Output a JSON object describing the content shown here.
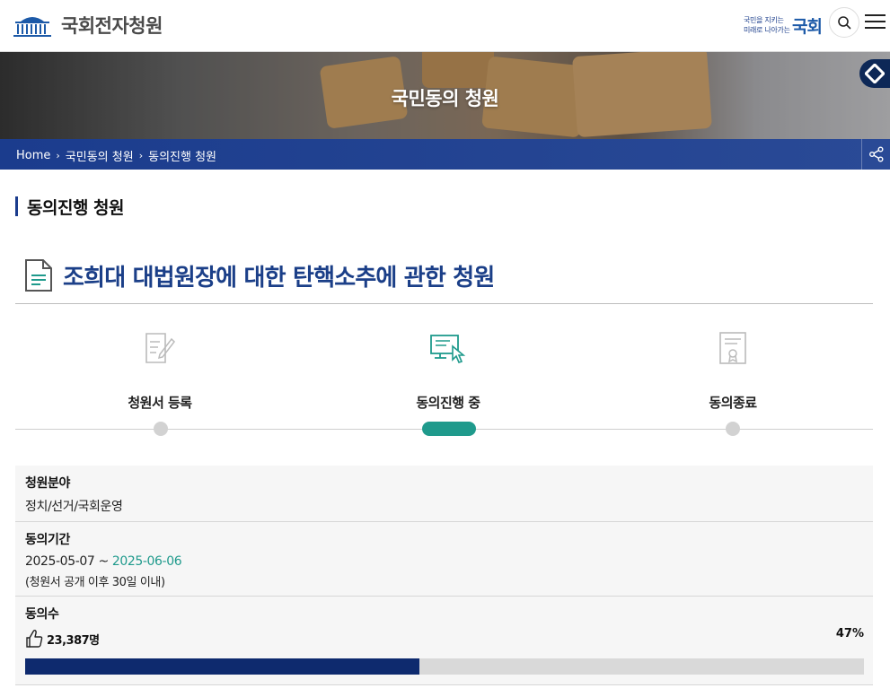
{
  "header": {
    "site_title": "국회전자청원",
    "slogan_line1": "국민을 지키는",
    "slogan_line2": "미래로 나아가는",
    "slogan_big": "국회",
    "search_icon": "search-icon",
    "menu_icon": "hamburger-menu-icon"
  },
  "banner": {
    "title": "국민동의 청원"
  },
  "breadcrumb": {
    "items": [
      "Home",
      "국민동의 청원",
      "동의진행 청원"
    ]
  },
  "section": {
    "title": "동의진행 청원"
  },
  "petition": {
    "title": "조희대 대법원장에 대한 탄핵소추에 관한 청원"
  },
  "steps": [
    {
      "label": "청원서 등록",
      "icon": "document-edit-icon",
      "active": false
    },
    {
      "label": "동의진행 중",
      "icon": "computer-click-icon",
      "active": true
    },
    {
      "label": "동의종료",
      "icon": "certificate-icon",
      "active": false
    }
  ],
  "info": {
    "field_label": "청원분야",
    "field_value": "정치/선거/국회운영",
    "period_label": "동의기간",
    "period_start": "2025-05-07",
    "period_tilde": "~",
    "period_end": "2025-06-06",
    "period_note": "(청원서 공개 이후 30일 이내)",
    "count_label": "동의수",
    "count_value": "23,387명",
    "percent_text": "47%",
    "progress_fraction": 0.47
  },
  "colors": {
    "brand_navy": "#1b3c8d",
    "teal_accent": "#1f9a8c",
    "progress_fill": "#0e2a6e"
  }
}
